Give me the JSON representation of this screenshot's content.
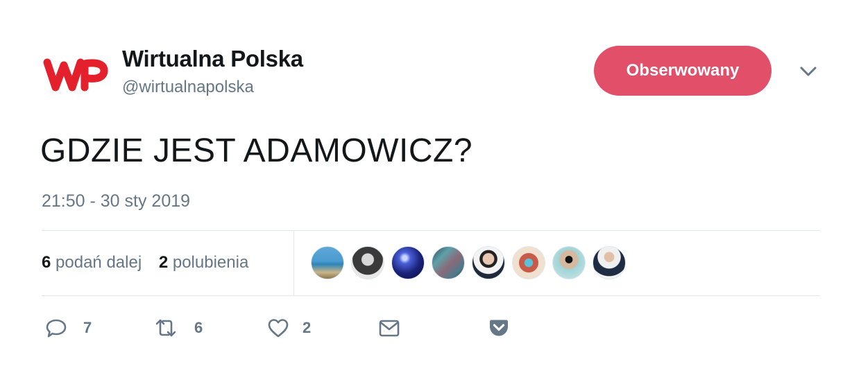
{
  "account": {
    "display_name": "Wirtualna Polska",
    "handle": "@wirtualnapolska",
    "logo_icon": "wp-logo-icon",
    "brand_color": "#e3202b"
  },
  "follow_button": {
    "label": "Obserwowany",
    "color": "#e14f69"
  },
  "menu_icon": "chevron-down-icon",
  "tweet": {
    "text": "GDZIE JEST ADAMOWICZ?",
    "timestamp": "21:50 - 30 sty 2019"
  },
  "stats": {
    "retweets_count": "6",
    "retweets_label": "podań dalej",
    "likes_count": "2",
    "likes_label": "polubienia"
  },
  "likers": [
    {
      "icon": "avatar-1"
    },
    {
      "icon": "avatar-2"
    },
    {
      "icon": "avatar-3"
    },
    {
      "icon": "avatar-4"
    },
    {
      "icon": "avatar-5"
    },
    {
      "icon": "avatar-6"
    },
    {
      "icon": "avatar-7"
    },
    {
      "icon": "avatar-8"
    }
  ],
  "actions": {
    "reply_count": "7",
    "retweet_count": "6",
    "like_count": "2",
    "reply_icon": "reply-icon",
    "retweet_icon": "retweet-icon",
    "like_icon": "heart-icon",
    "message_icon": "envelope-icon",
    "pocket_icon": "pocket-icon"
  }
}
